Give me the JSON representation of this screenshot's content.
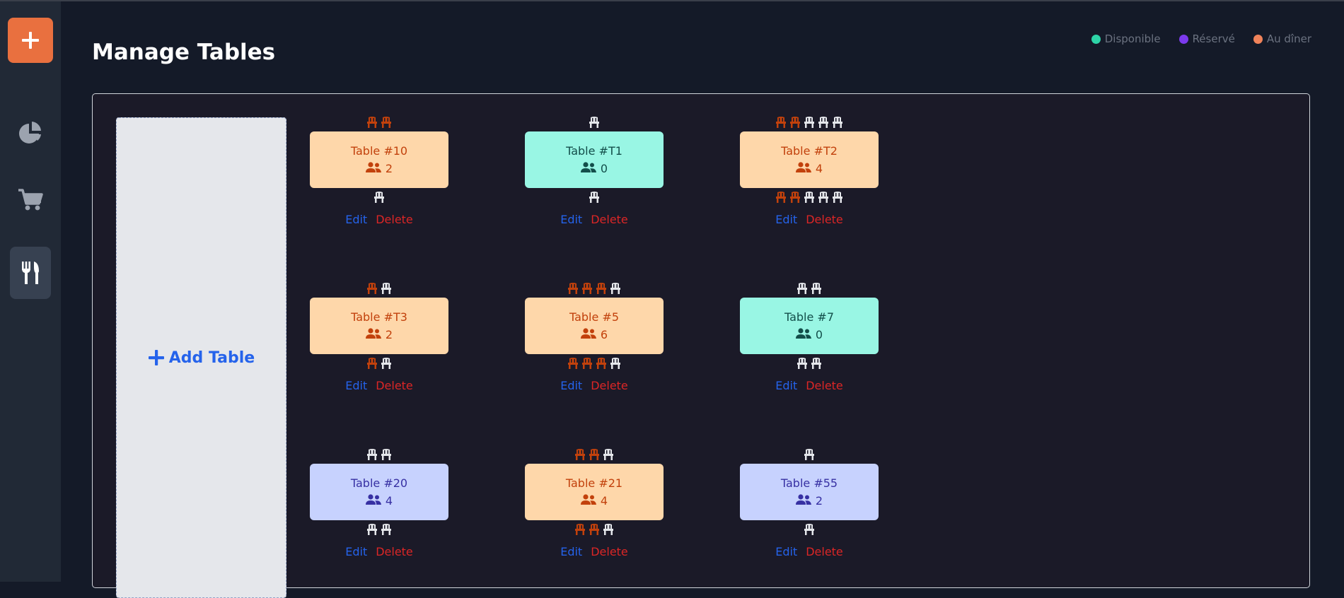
{
  "page": {
    "title": "Manage Tables"
  },
  "legend": [
    {
      "label": "Disponible",
      "color": "#2dd4a7"
    },
    {
      "label": "Réservé",
      "color": "#7c3aed"
    },
    {
      "label": "Au dîner",
      "color": "#f0835a"
    }
  ],
  "sidebar": {
    "items": [
      {
        "name": "add",
        "icon": "plus-icon"
      },
      {
        "name": "dashboard",
        "icon": "pie-chart-icon"
      },
      {
        "name": "orders",
        "icon": "cart-icon"
      },
      {
        "name": "tables",
        "icon": "utensils-icon",
        "active": true
      }
    ]
  },
  "add_table": {
    "label": "Add Table",
    "icon": "plus-icon"
  },
  "actions": {
    "edit_label": "Edit",
    "delete_label": "Delete"
  },
  "tables": [
    {
      "name": "Table #10",
      "guests": "2",
      "status": "dining",
      "chairs_top": [
        "o",
        "o"
      ],
      "chairs_bottom": [
        "w"
      ]
    },
    {
      "name": "Table #T1",
      "guests": "0",
      "status": "available",
      "chairs_top": [
        "w"
      ],
      "chairs_bottom": [
        "w"
      ]
    },
    {
      "name": "Table #T2",
      "guests": "4",
      "status": "dining",
      "chairs_top": [
        "o",
        "o",
        "w",
        "w",
        "w"
      ],
      "chairs_bottom": [
        "o",
        "o",
        "w",
        "w",
        "w"
      ]
    },
    {
      "name": "Table #T3",
      "guests": "2",
      "status": "dining",
      "chairs_top": [
        "o",
        "w"
      ],
      "chairs_bottom": [
        "o",
        "w"
      ]
    },
    {
      "name": "Table #5",
      "guests": "6",
      "status": "dining",
      "chairs_top": [
        "o",
        "o",
        "o",
        "w"
      ],
      "chairs_bottom": [
        "o",
        "o",
        "o",
        "w"
      ]
    },
    {
      "name": "Table #7",
      "guests": "0",
      "status": "available",
      "chairs_top": [
        "w",
        "w"
      ],
      "chairs_bottom": [
        "w",
        "w"
      ]
    },
    {
      "name": "Table #20",
      "guests": "4",
      "status": "reserved",
      "chairs_top": [
        "w",
        "w"
      ],
      "chairs_bottom": [
        "w",
        "w"
      ]
    },
    {
      "name": "Table #21",
      "guests": "4",
      "status": "dining",
      "chairs_top": [
        "o",
        "o",
        "w"
      ],
      "chairs_bottom": [
        "o",
        "o",
        "w"
      ]
    },
    {
      "name": "Table #55",
      "guests": "2",
      "status": "reserved",
      "chairs_top": [
        "w"
      ],
      "chairs_bottom": [
        "w"
      ]
    }
  ],
  "colors": {
    "chair_occupied": "#c2410c",
    "chair_free": "#e5e7eb",
    "accent": "#e9703f"
  }
}
